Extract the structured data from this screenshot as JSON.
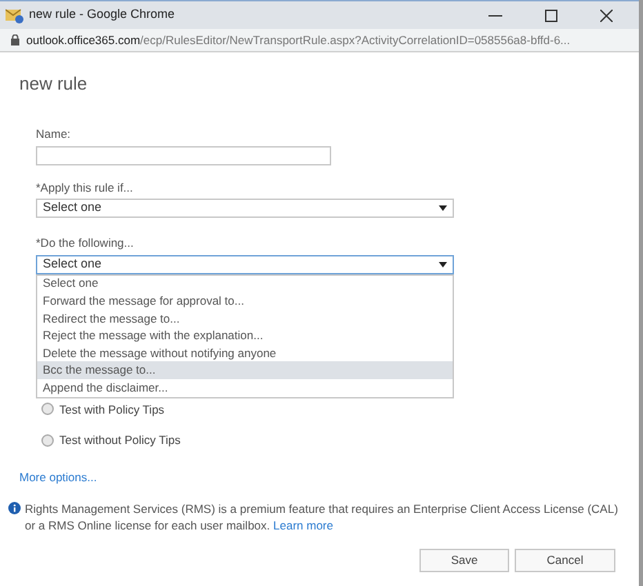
{
  "window": {
    "title": "new rule - Google Chrome"
  },
  "address_bar": {
    "host": "outlook.office365.com",
    "path": "/ecp/RulesEditor/NewTransportRule.aspx?ActivityCorrelationID=058556a8-bffd-6..."
  },
  "heading": "new rule",
  "name_field": {
    "label": "Name:"
  },
  "apply_select": {
    "label": "*Apply this rule if...",
    "value": "Select one"
  },
  "do_select": {
    "label": "*Do the following...",
    "value": "Select one",
    "expanded": true,
    "options": [
      {
        "label": "Select one",
        "highlighted": false
      },
      {
        "label": "Forward the message for approval to...",
        "highlighted": false
      },
      {
        "label": "Redirect the message to...",
        "highlighted": false
      },
      {
        "label": "Reject the message with the explanation...",
        "highlighted": false
      },
      {
        "label": "Delete the message without notifying anyone",
        "highlighted": false
      },
      {
        "label": "Bcc the message to...",
        "highlighted": true
      },
      {
        "label": "Append the disclaimer...",
        "highlighted": false
      }
    ]
  },
  "mode_radios": [
    {
      "label": "Test with Policy Tips",
      "selected": false
    },
    {
      "label": "Test without Policy Tips",
      "selected": false
    }
  ],
  "more_options": "More options...",
  "info": {
    "text": "Rights Management Services (RMS) is a premium feature that requires an Enterprise Client Access License (CAL) or a RMS Online license for each user mailbox.",
    "link": "Learn more"
  },
  "buttons": [
    "Save",
    "Cancel"
  ]
}
